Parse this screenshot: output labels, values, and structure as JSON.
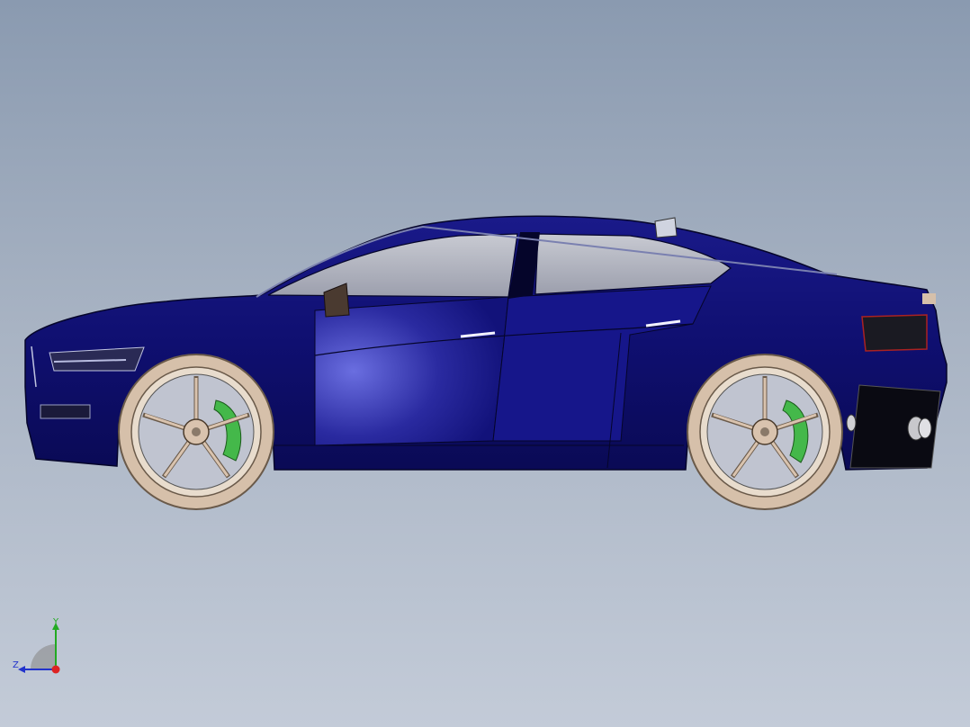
{
  "viewport": {
    "background_top": "#8a9ab0",
    "background_bottom": "#c3cbd8"
  },
  "model": {
    "body_color": "#121277",
    "body_highlight": "#5a5fd8",
    "glass_color": "#b8bac4",
    "rim_color": "#d9c3ae",
    "brake_caliper_color": "#44b84a",
    "tire_color": "#d6c0aa"
  },
  "triad": {
    "y_label": "Y",
    "z_label": "Z",
    "y_color": "#22aa22",
    "z_color": "#2233cc",
    "x_color": "#dd2222"
  }
}
